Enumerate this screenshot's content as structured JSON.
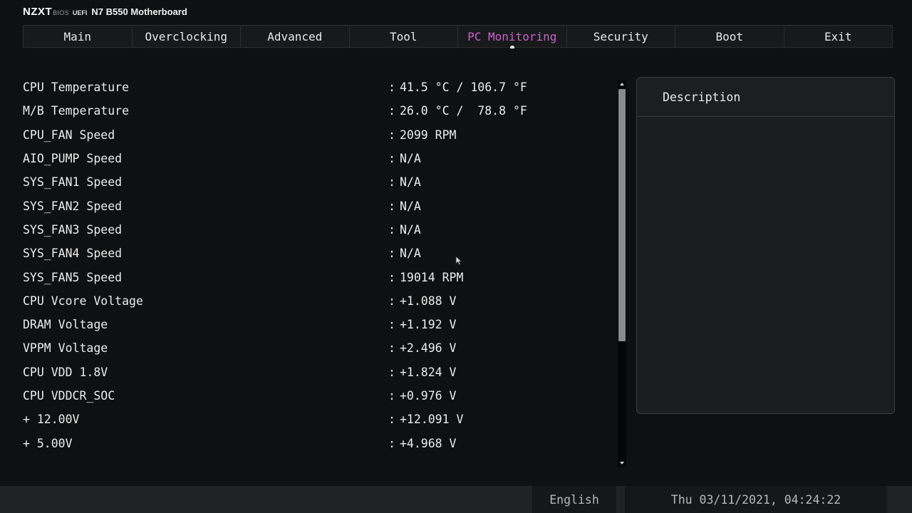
{
  "header": {
    "logo": "NZXT",
    "bios": "BIOS",
    "uefi": "UEFI",
    "board": "N7 B550 Motherboard"
  },
  "nav": {
    "active": "PC Monitoring",
    "tabs": [
      {
        "label": "Main"
      },
      {
        "label": "Overclocking"
      },
      {
        "label": "Advanced"
      },
      {
        "label": "Tool"
      },
      {
        "label": "PC Monitoring"
      },
      {
        "label": "Security"
      },
      {
        "label": "Boot"
      },
      {
        "label": "Exit"
      }
    ]
  },
  "monitoring": {
    "separator": ":",
    "items": [
      {
        "label": "CPU Temperature",
        "value": "41.5 °C / 106.7 °F"
      },
      {
        "label": "M/B Temperature",
        "value": "26.0 °C /  78.8 °F"
      },
      {
        "label": "CPU_FAN Speed",
        "value": "2099 RPM"
      },
      {
        "label": "AIO_PUMP Speed",
        "value": "N/A"
      },
      {
        "label": "SYS_FAN1 Speed",
        "value": "N/A"
      },
      {
        "label": "SYS_FAN2 Speed",
        "value": "N/A"
      },
      {
        "label": "SYS_FAN3 Speed",
        "value": "N/A"
      },
      {
        "label": "SYS_FAN4 Speed",
        "value": "N/A"
      },
      {
        "label": "SYS_FAN5 Speed",
        "value": "19014 RPM"
      },
      {
        "label": "CPU Vcore Voltage",
        "value": "+1.088 V"
      },
      {
        "label": "DRAM Voltage",
        "value": "+1.192 V"
      },
      {
        "label": "VPPM Voltage",
        "value": "+2.496 V"
      },
      {
        "label": "CPU VDD 1.8V",
        "value": "+1.824 V"
      },
      {
        "label": "CPU VDDCR_SOC",
        "value": "+0.976 V"
      },
      {
        "label": "+ 12.00V",
        "value": "+12.091 V"
      },
      {
        "label": "+ 5.00V",
        "value": "+4.968 V"
      }
    ]
  },
  "description": {
    "title": "Description",
    "body": ""
  },
  "footer": {
    "language": "English",
    "datetime": "Thu 03/11/2021, 04:24:22"
  },
  "colors": {
    "background": "#0f1011",
    "active_tab": "#c864cc",
    "text": "#ececec"
  }
}
